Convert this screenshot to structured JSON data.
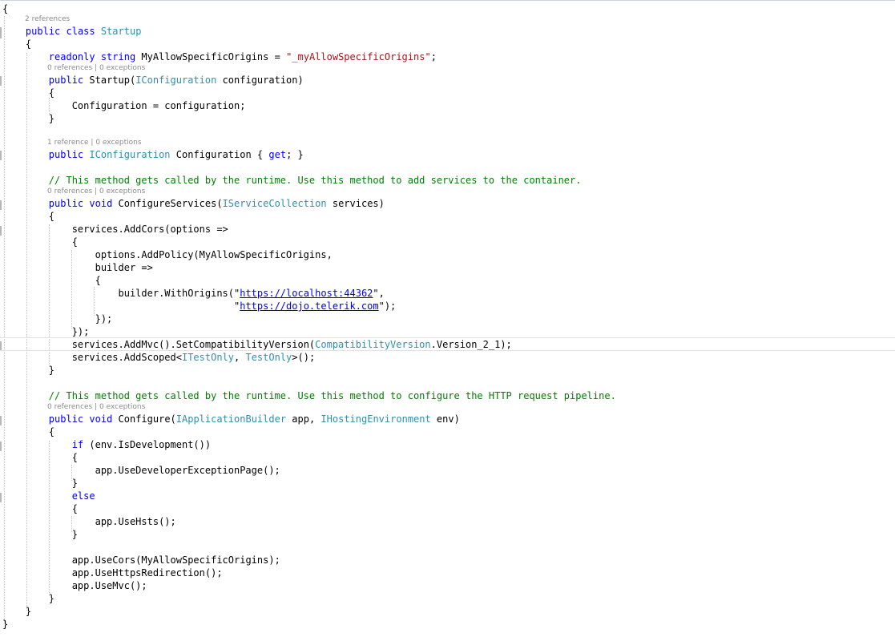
{
  "code_lens": {
    "class_refs": "2 references",
    "ctor_lens": "0 references | 0 exceptions",
    "prop_lens": "1 reference | 0 exceptions",
    "config_services_lens": "0 references | 0 exceptions",
    "configure_lens": "0 references | 0 exceptions"
  },
  "tokens": {
    "public": "public",
    "class": "class",
    "readonly": "readonly",
    "string": "string",
    "void": "void",
    "get": "get",
    "if": "if",
    "else": "else"
  },
  "code": {
    "open_brace": "{",
    "close_brace": "}",
    "class_name": "Startup",
    "origins_field": "MyAllowSpecificOrigins",
    "equals": " = ",
    "origins_value": "\"_myAllowSpecificOrigins\"",
    "semicolon": ";",
    "ctor_name": "Startup(",
    "iconfiguration": "IConfiguration",
    "ctor_param": " configuration)",
    "ctor_body": "Configuration = configuration;",
    "prop_name": " Configuration { ",
    "prop_end": "; }",
    "comment_services": "// This method gets called by the runtime. Use this method to add services to the container.",
    "configure_services_name": "ConfigureServices(",
    "iservicecollection": "IServiceCollection",
    "services_param": " services)",
    "add_cors": "services.AddCors(options =>",
    "add_policy": "options.AddPolicy(MyAllowSpecificOrigins,",
    "builder_arrow": "builder =>",
    "with_origins": "builder.WithOrigins(",
    "url_localhost": "https://localhost:44362",
    "url_dojo": "https://dojo.telerik.com",
    "quote": "\"",
    "quote_comma": "\",",
    "quote_close": "\");",
    "close_lambda": "});",
    "add_mvc": "services.AddMvc().SetCompatibilityVersion(",
    "compat_version_type": "CompatibilityVersion",
    "compat_version_value": ".Version_2_1);",
    "add_scoped": "services.AddScoped<",
    "itestonly": "ITestOnly",
    "comma_space": ", ",
    "testonly": "TestOnly",
    "add_scoped_end": ">();",
    "comment_configure": "// This method gets called by the runtime. Use this method to configure the HTTP request pipeline.",
    "configure_name": "Configure(",
    "iapplicationbuilder": "IApplicationBuilder",
    "app_param": " app, ",
    "ihostingenvironment": "IHostingEnvironment",
    "env_param": " env)",
    "is_development": " (env.IsDevelopment())",
    "use_dev_exception": "app.UseDeveloperExceptionPage();",
    "use_hsts": "app.UseHsts();",
    "use_cors": "app.UseCors(MyAllowSpecificOrigins);",
    "use_https": "app.UseHttpsRedirection();",
    "use_mvc": "app.UseMvc();"
  }
}
